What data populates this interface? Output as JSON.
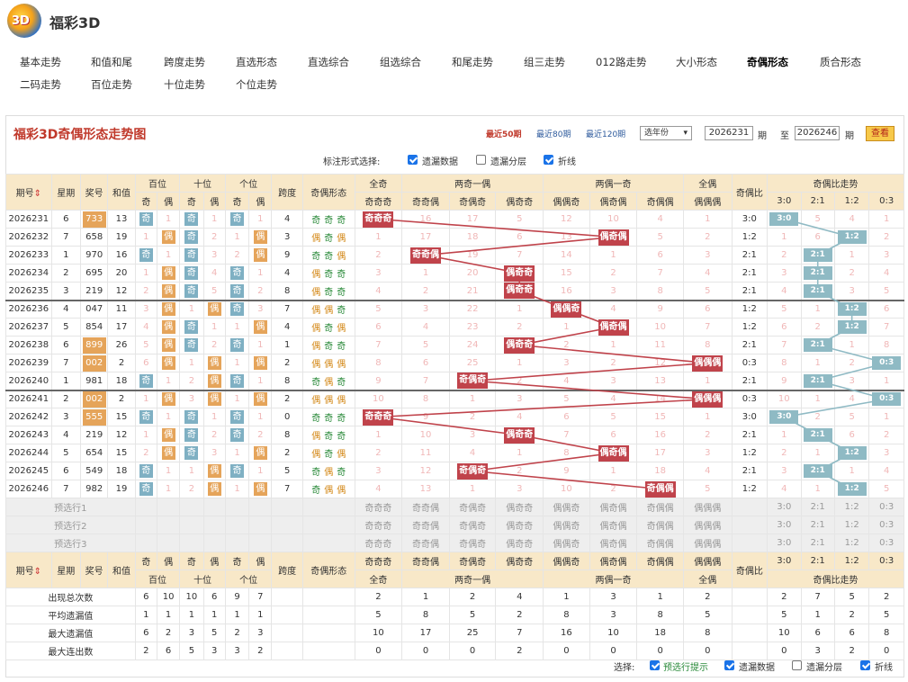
{
  "site": {
    "title": "福彩3D",
    "logo_text": "3D"
  },
  "nav": [
    [
      "基本走势",
      "和值和尾",
      "跨度走势",
      "直选形态",
      "直选综合",
      "组选综合",
      "和尾走势",
      "组三走势",
      "012路走势",
      "大小形态",
      "奇偶形态",
      "质合形态"
    ],
    [
      "二码走势",
      "百位走势",
      "十位走势",
      "个位走势"
    ]
  ],
  "nav_active": "奇偶形态",
  "panel": {
    "title": "福彩3D奇偶形态走势图",
    "periods": [
      "最近50期",
      "最近80期",
      "最近120期"
    ],
    "year_select": "选年份",
    "from_label": "期",
    "to_label": "至",
    "to_suffix": "期",
    "from": "2026231",
    "to": "2026246",
    "view_btn": "查看",
    "mark_label": "标注形式选择:",
    "mark_opts": [
      {
        "label": "遗漏数据",
        "on": true
      },
      {
        "label": "遗漏分层",
        "on": false
      },
      {
        "label": "折线",
        "on": true
      }
    ]
  },
  "header": {
    "top": [
      "期号",
      "星期",
      "奖号",
      "和值",
      "百位",
      "十位",
      "个位",
      "跨度",
      "奇偶形态",
      "全奇",
      "两奇一偶",
      "两偶一奇",
      "全偶",
      "奇偶比",
      "奇偶比走势"
    ],
    "sub": [
      "奇",
      "偶",
      "奇",
      "偶",
      "奇",
      "偶",
      "奇奇奇",
      "奇奇偶",
      "奇偶奇",
      "偶奇奇",
      "偶偶奇",
      "偶奇偶",
      "奇偶偶",
      "偶偶偶",
      "3:0",
      "2:1",
      "1:2",
      "0:3"
    ]
  },
  "forms": [
    "奇奇奇",
    "奇奇偶",
    "奇偶奇",
    "偶奇奇",
    "偶偶奇",
    "偶奇偶",
    "奇偶偶",
    "偶偶偶"
  ],
  "ratios": [
    "3:0",
    "2:1",
    "1:2",
    "0:3"
  ],
  "rows": [
    {
      "issue": "2026231",
      "week": "6",
      "num": "733",
      "hl": true,
      "sum": "13",
      "pos": [
        [
          "奇",
          "1"
        ],
        [
          "奇",
          "1"
        ],
        [
          "奇",
          "1"
        ]
      ],
      "span": "4",
      "form": [
        "奇",
        "奇",
        "奇"
      ],
      "forms": [
        "奇奇奇",
        "16",
        "17",
        "5",
        "12",
        "10",
        "4",
        "1"
      ],
      "ratio": "3:0",
      "rt": [
        "3:0",
        "5",
        "4",
        "1"
      ]
    },
    {
      "issue": "2026232",
      "week": "7",
      "num": "658",
      "hl": false,
      "sum": "19",
      "pos": [
        [
          "1",
          "偶"
        ],
        [
          "奇",
          "2"
        ],
        [
          "1",
          "偶"
        ]
      ],
      "span": "3",
      "form": [
        "偶",
        "奇",
        "偶"
      ],
      "forms": [
        "1",
        "17",
        "18",
        "6",
        "13",
        "偶奇偶",
        "5",
        "2"
      ],
      "ratio": "1:2",
      "rt": [
        "1",
        "6",
        "1:2",
        "2"
      ]
    },
    {
      "issue": "2026233",
      "week": "1",
      "num": "970",
      "hl": false,
      "sum": "16",
      "pos": [
        [
          "奇",
          "1"
        ],
        [
          "奇",
          "3"
        ],
        [
          "2",
          "偶"
        ]
      ],
      "span": "9",
      "form": [
        "奇",
        "奇",
        "偶"
      ],
      "forms": [
        "2",
        "奇奇偶",
        "19",
        "7",
        "14",
        "1",
        "6",
        "3"
      ],
      "ratio": "2:1",
      "rt": [
        "2",
        "2:1",
        "1",
        "3"
      ]
    },
    {
      "issue": "2026234",
      "week": "2",
      "num": "695",
      "hl": false,
      "sum": "20",
      "pos": [
        [
          "1",
          "偶"
        ],
        [
          "奇",
          "4"
        ],
        [
          "奇",
          "1"
        ]
      ],
      "span": "4",
      "form": [
        "偶",
        "奇",
        "奇"
      ],
      "forms": [
        "3",
        "1",
        "20",
        "偶奇奇",
        "15",
        "2",
        "7",
        "4"
      ],
      "ratio": "2:1",
      "rt": [
        "3",
        "2:1",
        "2",
        "4"
      ]
    },
    {
      "issue": "2026235",
      "week": "3",
      "num": "219",
      "hl": false,
      "sum": "12",
      "pos": [
        [
          "2",
          "偶"
        ],
        [
          "奇",
          "5"
        ],
        [
          "奇",
          "2"
        ]
      ],
      "span": "8",
      "form": [
        "偶",
        "奇",
        "奇"
      ],
      "forms": [
        "4",
        "2",
        "21",
        "偶奇奇",
        "16",
        "3",
        "8",
        "5"
      ],
      "ratio": "2:1",
      "rt": [
        "4",
        "2:1",
        "3",
        "5"
      ]
    },
    {
      "issue": "2026236",
      "week": "4",
      "num": "047",
      "hl": false,
      "sum": "11",
      "pos": [
        [
          "3",
          "偶"
        ],
        [
          "1",
          "偶"
        ],
        [
          "奇",
          "3"
        ]
      ],
      "span": "7",
      "form": [
        "偶",
        "偶",
        "奇"
      ],
      "forms": [
        "5",
        "3",
        "22",
        "1",
        "偶偶奇",
        "4",
        "9",
        "6"
      ],
      "ratio": "1:2",
      "rt": [
        "5",
        "1",
        "1:2",
        "6"
      ]
    },
    {
      "issue": "2026237",
      "week": "5",
      "num": "854",
      "hl": false,
      "sum": "17",
      "pos": [
        [
          "4",
          "偶"
        ],
        [
          "奇",
          "1"
        ],
        [
          "1",
          "偶"
        ]
      ],
      "span": "4",
      "form": [
        "偶",
        "奇",
        "偶"
      ],
      "forms": [
        "6",
        "4",
        "23",
        "2",
        "1",
        "偶奇偶",
        "10",
        "7"
      ],
      "ratio": "1:2",
      "rt": [
        "6",
        "2",
        "1:2",
        "7"
      ]
    },
    {
      "issue": "2026238",
      "week": "6",
      "num": "899",
      "hl": true,
      "sum": "26",
      "pos": [
        [
          "5",
          "偶"
        ],
        [
          "奇",
          "2"
        ],
        [
          "奇",
          "1"
        ]
      ],
      "span": "1",
      "form": [
        "偶",
        "奇",
        "奇"
      ],
      "forms": [
        "7",
        "5",
        "24",
        "偶奇奇",
        "2",
        "1",
        "11",
        "8"
      ],
      "ratio": "2:1",
      "rt": [
        "7",
        "2:1",
        "1",
        "8"
      ]
    },
    {
      "issue": "2026239",
      "week": "7",
      "num": "002",
      "hl": true,
      "sum": "2",
      "pos": [
        [
          "6",
          "偶"
        ],
        [
          "1",
          "偶"
        ],
        [
          "1",
          "偶"
        ]
      ],
      "span": "2",
      "form": [
        "偶",
        "偶",
        "偶"
      ],
      "forms": [
        "8",
        "6",
        "25",
        "1",
        "3",
        "2",
        "12",
        "偶偶偶"
      ],
      "ratio": "0:3",
      "rt": [
        "8",
        "1",
        "2",
        "0:3"
      ]
    },
    {
      "issue": "2026240",
      "week": "1",
      "num": "981",
      "hl": false,
      "sum": "18",
      "pos": [
        [
          "奇",
          "1"
        ],
        [
          "2",
          "偶"
        ],
        [
          "奇",
          "1"
        ]
      ],
      "span": "8",
      "form": [
        "奇",
        "偶",
        "奇"
      ],
      "forms": [
        "9",
        "7",
        "奇偶奇",
        "2",
        "4",
        "3",
        "13",
        "1"
      ],
      "ratio": "2:1",
      "rt": [
        "9",
        "2:1",
        "3",
        "1"
      ]
    },
    {
      "issue": "2026241",
      "week": "2",
      "num": "002",
      "hl": true,
      "sum": "2",
      "pos": [
        [
          "1",
          "偶"
        ],
        [
          "3",
          "偶"
        ],
        [
          "1",
          "偶"
        ]
      ],
      "span": "2",
      "form": [
        "偶",
        "偶",
        "偶"
      ],
      "forms": [
        "10",
        "8",
        "1",
        "3",
        "5",
        "4",
        "14",
        "偶偶偶"
      ],
      "ratio": "0:3",
      "rt": [
        "10",
        "1",
        "4",
        "0:3"
      ]
    },
    {
      "issue": "2026242",
      "week": "3",
      "num": "555",
      "hl": true,
      "sum": "15",
      "pos": [
        [
          "奇",
          "1"
        ],
        [
          "奇",
          "1"
        ],
        [
          "奇",
          "1"
        ]
      ],
      "span": "0",
      "form": [
        "奇",
        "奇",
        "奇"
      ],
      "forms": [
        "奇奇奇",
        "9",
        "2",
        "4",
        "6",
        "5",
        "15",
        "1"
      ],
      "ratio": "3:0",
      "rt": [
        "3:0",
        "2",
        "5",
        "1"
      ]
    },
    {
      "issue": "2026243",
      "week": "4",
      "num": "219",
      "hl": false,
      "sum": "12",
      "pos": [
        [
          "1",
          "偶"
        ],
        [
          "奇",
          "2"
        ],
        [
          "奇",
          "2"
        ]
      ],
      "span": "8",
      "form": [
        "偶",
        "奇",
        "奇"
      ],
      "forms": [
        "1",
        "10",
        "3",
        "偶奇奇",
        "7",
        "6",
        "16",
        "2"
      ],
      "ratio": "2:1",
      "rt": [
        "1",
        "2:1",
        "6",
        "2"
      ]
    },
    {
      "issue": "2026244",
      "week": "5",
      "num": "654",
      "hl": false,
      "sum": "15",
      "pos": [
        [
          "2",
          "偶"
        ],
        [
          "奇",
          "3"
        ],
        [
          "1",
          "偶"
        ]
      ],
      "span": "2",
      "form": [
        "偶",
        "奇",
        "偶"
      ],
      "forms": [
        "2",
        "11",
        "4",
        "1",
        "8",
        "偶奇偶",
        "17",
        "3"
      ],
      "ratio": "1:2",
      "rt": [
        "2",
        "1",
        "1:2",
        "3"
      ]
    },
    {
      "issue": "2026245",
      "week": "6",
      "num": "549",
      "hl": false,
      "sum": "18",
      "pos": [
        [
          "奇",
          "1"
        ],
        [
          "1",
          "偶"
        ],
        [
          "奇",
          "1"
        ]
      ],
      "span": "5",
      "form": [
        "奇",
        "偶",
        "奇"
      ],
      "forms": [
        "3",
        "12",
        "奇偶奇",
        "2",
        "9",
        "1",
        "18",
        "4"
      ],
      "ratio": "2:1",
      "rt": [
        "3",
        "2:1",
        "1",
        "4"
      ]
    },
    {
      "issue": "2026246",
      "week": "7",
      "num": "982",
      "hl": false,
      "sum": "19",
      "pos": [
        [
          "奇",
          "1"
        ],
        [
          "2",
          "偶"
        ],
        [
          "1",
          "偶"
        ]
      ],
      "span": "7",
      "form": [
        "奇",
        "偶",
        "偶"
      ],
      "forms": [
        "4",
        "13",
        "1",
        "3",
        "10",
        "2",
        "奇偶偶",
        "5"
      ],
      "ratio": "1:2",
      "rt": [
        "4",
        "1",
        "1:2",
        "5"
      ]
    }
  ],
  "forecast": [
    "预选行1",
    "预选行2",
    "预选行3"
  ],
  "footer_headers": {
    "groups": [
      "百位",
      "十位",
      "个位"
    ],
    "form_groups": [
      "全奇",
      "两奇一偶",
      "两偶一奇",
      "全偶"
    ],
    "ratio_group": "奇偶比走势"
  },
  "stats": [
    {
      "label": "出现总次数",
      "pos": [
        "6",
        "10",
        "10",
        "6",
        "9",
        "7"
      ],
      "forms": [
        "2",
        "1",
        "2",
        "4",
        "1",
        "3",
        "1",
        "2"
      ],
      "rt": [
        "2",
        "7",
        "5",
        "2"
      ]
    },
    {
      "label": "平均遗漏值",
      "pos": [
        "1",
        "1",
        "1",
        "1",
        "1",
        "1"
      ],
      "forms": [
        "5",
        "8",
        "5",
        "2",
        "8",
        "3",
        "8",
        "5"
      ],
      "rt": [
        "5",
        "1",
        "2",
        "5"
      ]
    },
    {
      "label": "最大遗漏值",
      "pos": [
        "6",
        "2",
        "3",
        "5",
        "2",
        "3"
      ],
      "forms": [
        "10",
        "17",
        "25",
        "7",
        "16",
        "10",
        "18",
        "8"
      ],
      "rt": [
        "10",
        "6",
        "6",
        "8"
      ]
    },
    {
      "label": "最大连出数",
      "pos": [
        "2",
        "6",
        "5",
        "3",
        "3",
        "2"
      ],
      "forms": [
        "0",
        "0",
        "0",
        "2",
        "0",
        "0",
        "0",
        "0"
      ],
      "rt": [
        "0",
        "3",
        "2",
        "0"
      ]
    }
  ],
  "bottom": {
    "label": "选择:",
    "opts": [
      {
        "label": "预选行提示",
        "on": true,
        "green": true
      },
      {
        "label": "遗漏数据",
        "on": true
      },
      {
        "label": "遗漏分层",
        "on": false
      },
      {
        "label": "折线",
        "on": true
      }
    ]
  }
}
